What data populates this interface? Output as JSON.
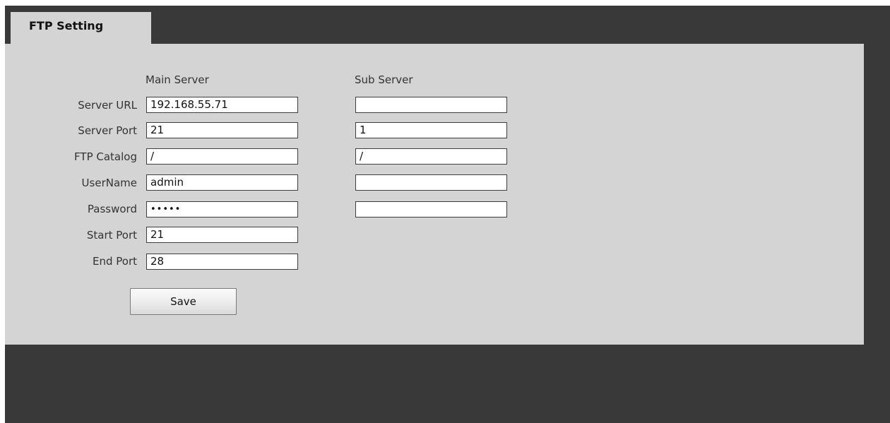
{
  "tab": {
    "title": "FTP Setting"
  },
  "columns": {
    "main": "Main Server",
    "sub": "Sub Server"
  },
  "rows": [
    {
      "label": "Server URL",
      "main": "192.168.55.71",
      "sub": ""
    },
    {
      "label": "Server Port",
      "main": "21",
      "sub": "1"
    },
    {
      "label": "FTP Catalog",
      "main": "/",
      "sub": "/"
    },
    {
      "label": "UserName",
      "main": "admin",
      "sub": ""
    },
    {
      "label": "Password",
      "main": "•••••",
      "sub": ""
    },
    {
      "label": "Start Port",
      "main": "21"
    },
    {
      "label": "End Port",
      "main": "28"
    }
  ],
  "actions": {
    "save_label": "Save"
  },
  "colors": {
    "frame": "#393939",
    "panel": "#d4d4d4",
    "field_border": "#3d3d3d"
  }
}
